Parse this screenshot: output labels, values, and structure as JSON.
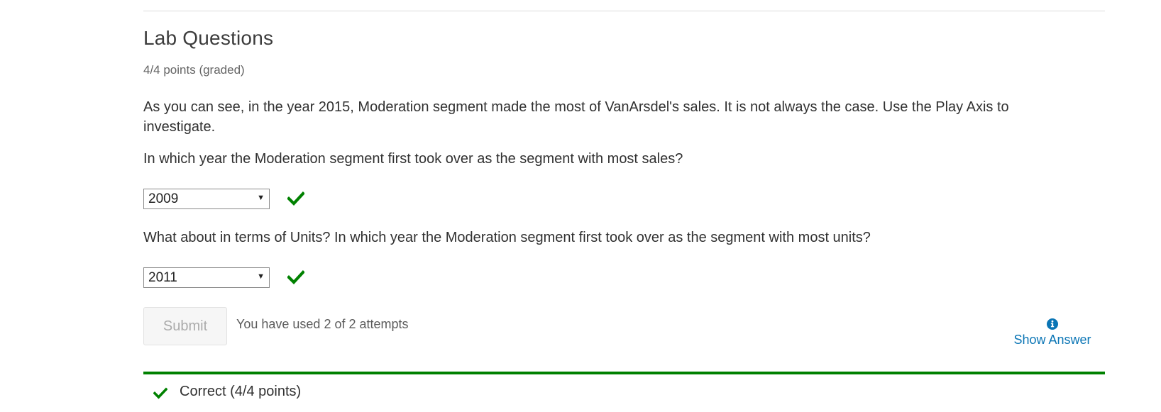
{
  "problem": {
    "title": "Lab Questions",
    "points": "4/4 points (graded)",
    "intro": "As you can see, in the year 2015, Moderation segment made the most of VanArsdel's sales. It is not always the case. Use the Play Axis to investigate.",
    "questions": [
      {
        "text": "In which year the Moderation segment first took over as the segment with most sales?",
        "selected": "2009",
        "result_icon": "check-icon"
      },
      {
        "text": "What about in terms of Units? In which year the Moderation segment first took over as the segment with most units?",
        "selected": "2011",
        "result_icon": "check-icon"
      }
    ]
  },
  "actions": {
    "submit_label": "Submit",
    "attempts_text": "You have used 2 of 2 attempts",
    "show_answer_label": "Show Answer",
    "show_answer_icon": "info-circle-icon"
  },
  "status": {
    "icon": "check-icon",
    "text": "Correct (4/4 points)"
  },
  "colors": {
    "correct_green": "#008100",
    "link_blue": "#0a75b5",
    "rule_gray": "#dcdcdc"
  }
}
